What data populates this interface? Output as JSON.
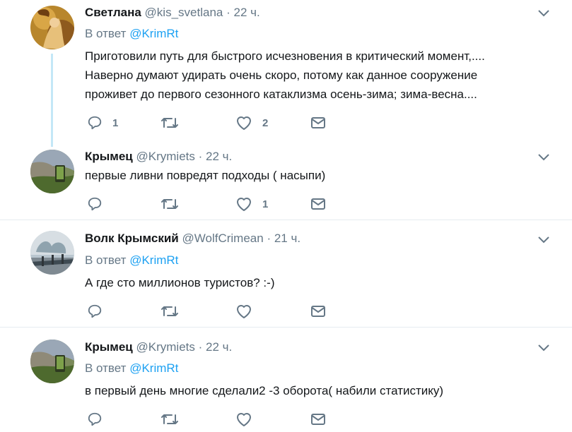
{
  "tweets": [
    {
      "name": "Светлана",
      "handle": "@kis_svetlana",
      "time": "22 ч.",
      "reply_prefix": "В ответ",
      "reply_to": "@KrimRt",
      "text_lines": [
        "Приготовили путь для быстрого исчезновения в критический момент,....",
        "Наверно думают удирать очень скоро, потому как данное сооружение",
        "проживет до первого сезонного катаклизма осень-зима; зима-весна...."
      ],
      "reply_count": "1",
      "retweet_count": "",
      "like_count": "2"
    },
    {
      "name": "Крымец",
      "handle": "@Krymiets",
      "time": "22 ч.",
      "text_lines": [
        "первые ливни повредят подходы ( насыпи)"
      ],
      "reply_count": "",
      "retweet_count": "",
      "like_count": "1"
    },
    {
      "name": "Волк Крымский",
      "handle": "@WolfCrimean",
      "time": "21 ч.",
      "reply_prefix": "В ответ",
      "reply_to": "@KrimRt",
      "text_lines": [
        "А где сто миллионов туристов? :-)"
      ],
      "reply_count": "",
      "retweet_count": "",
      "like_count": ""
    },
    {
      "name": "Крымец",
      "handle": "@Krymiets",
      "time": "22 ч.",
      "reply_prefix": "В ответ",
      "reply_to": "@KrimRt",
      "text_lines": [
        "в первый день многие сделали2 -3 оборота( набили статистику)"
      ],
      "reply_count": "",
      "retweet_count": "",
      "like_count": ""
    }
  ],
  "separator": "·",
  "colors": {
    "link": "#1da1f2",
    "muted": "#657786",
    "text": "#14171a",
    "thread_line": "#c4e7f7",
    "divider": "#e6ecf0"
  },
  "icons": {
    "reply": "reply-icon",
    "retweet": "retweet-icon",
    "like": "heart-icon",
    "message": "envelope-icon",
    "more": "chevron-down-icon"
  }
}
